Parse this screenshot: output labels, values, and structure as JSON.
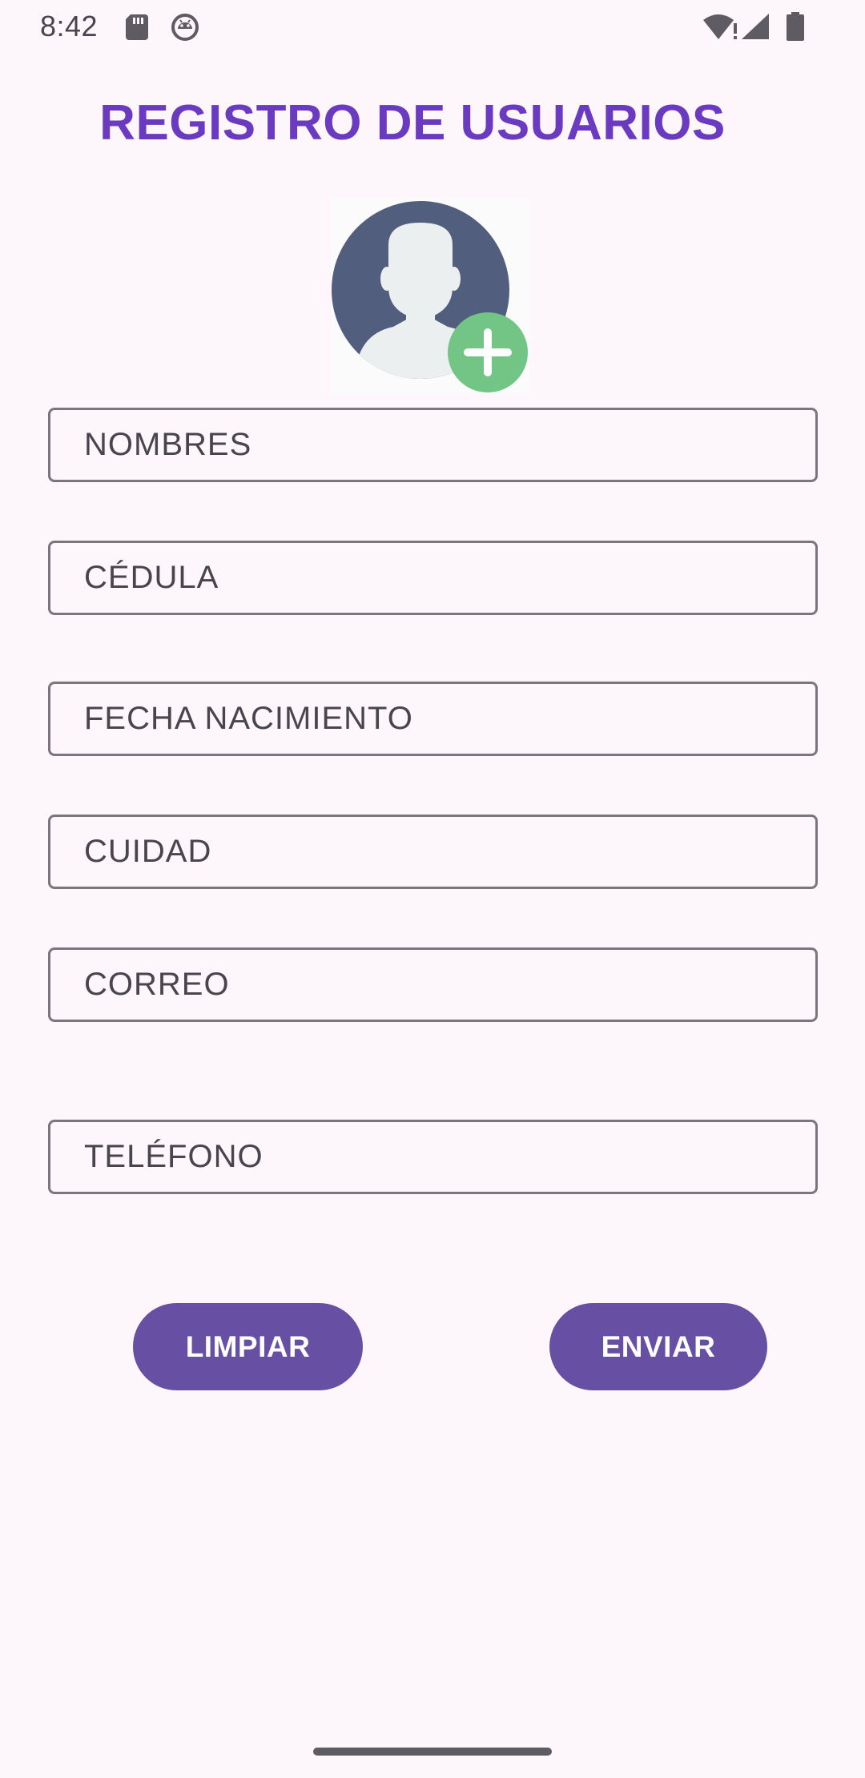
{
  "status_bar": {
    "time": "8:42",
    "icons": [
      "sd-card-icon",
      "android-debug-icon",
      "wifi-alert-icon",
      "cell-signal-icon",
      "battery-icon"
    ]
  },
  "page": {
    "title": "REGISTRO DE USUARIOS"
  },
  "avatar": {
    "icon": "user-avatar-icon",
    "badge_icon": "add-plus-icon"
  },
  "form": {
    "fields": [
      {
        "name": "nombres",
        "placeholder": "NOMBRES",
        "value": ""
      },
      {
        "name": "cedula",
        "placeholder": "CÉDULA",
        "value": ""
      },
      {
        "name": "fecha_nacimiento",
        "placeholder": "FECHA NACIMIENTO",
        "value": ""
      },
      {
        "name": "ciudad",
        "placeholder": "CUIDAD",
        "value": ""
      },
      {
        "name": "correo",
        "placeholder": "CORREO",
        "value": ""
      },
      {
        "name": "telefono",
        "placeholder": "TELÉFONO",
        "value": ""
      }
    ]
  },
  "buttons": {
    "clear_label": "LIMPIAR",
    "send_label": "ENVIAR"
  },
  "colors": {
    "background": "#fdf7fc",
    "title": "#6a3bc0",
    "button": "#6750a4",
    "avatar_circle": "#525e7d",
    "avatar_silhouette": "#eceff0",
    "plus_badge": "#72c585",
    "field_border": "#7a757f"
  }
}
